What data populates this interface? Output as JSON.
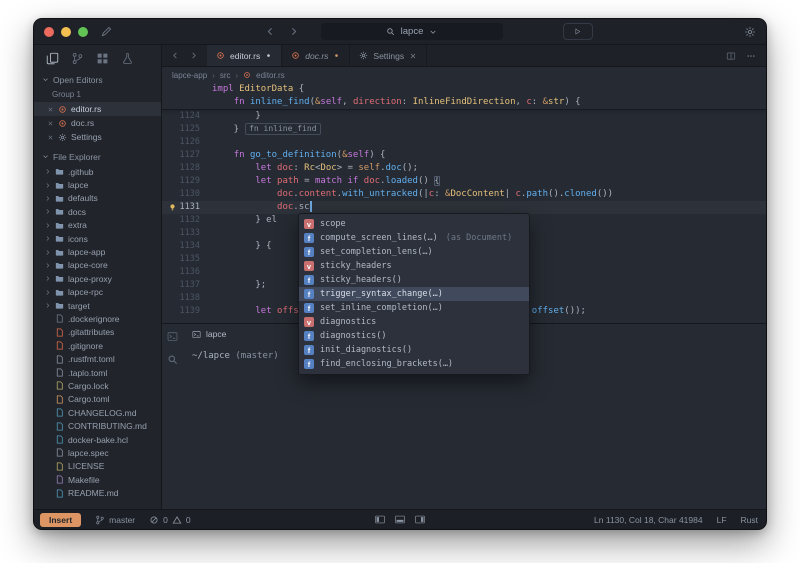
{
  "colors": {
    "accent_blue": "#61afef",
    "mode_insert": "#dd9563",
    "rust_orange": "#d87050",
    "folder": "#7f93ad",
    "traffic": [
      "#ec6a5e",
      "#f4bf50",
      "#61c454"
    ]
  },
  "titlebar": {
    "search_value": "lapce"
  },
  "activity": {
    "items": [
      {
        "name": "file-explorer",
        "icon": "files",
        "active": true
      },
      {
        "name": "source-control",
        "icon": "branch",
        "active": false
      },
      {
        "name": "extensions",
        "icon": "grid",
        "active": false
      },
      {
        "name": "debug",
        "icon": "flask",
        "active": false
      }
    ]
  },
  "sidebar": {
    "open_editors_label": "Open Editors",
    "group_label": "Group 1",
    "open_editors": [
      {
        "label": "editor.rs",
        "icon": "rust",
        "icon_color": "#d87050",
        "active": true
      },
      {
        "label": "doc.rs",
        "icon": "rust",
        "icon_color": "#d87050",
        "active": false
      },
      {
        "label": "Settings",
        "icon": "gear",
        "icon_color": "#8b93a2",
        "active": false
      }
    ],
    "file_explorer_label": "File Explorer",
    "tree": [
      {
        "label": ".github",
        "type": "folder"
      },
      {
        "label": "lapce",
        "type": "folder"
      },
      {
        "label": "defaults",
        "type": "folder"
      },
      {
        "label": "docs",
        "type": "folder"
      },
      {
        "label": "extra",
        "type": "folder"
      },
      {
        "label": "icons",
        "type": "folder"
      },
      {
        "label": "lapce-app",
        "type": "folder"
      },
      {
        "label": "lapce-core",
        "type": "folder"
      },
      {
        "label": "lapce-proxy",
        "type": "folder"
      },
      {
        "label": "lapce-rpc",
        "type": "folder"
      },
      {
        "label": "target",
        "type": "folder"
      },
      {
        "label": ".dockerignore",
        "type": "file",
        "color": "#6e7a8a"
      },
      {
        "label": ".gitattributes",
        "type": "file",
        "color": "#de6b48"
      },
      {
        "label": ".gitignore",
        "type": "file",
        "color": "#de6b48"
      },
      {
        "label": ".rustfmt.toml",
        "type": "file",
        "color": "#8b93a2"
      },
      {
        "label": ".taplo.toml",
        "type": "file",
        "color": "#8b93a2"
      },
      {
        "label": "Cargo.lock",
        "type": "file",
        "color": "#b8a965"
      },
      {
        "label": "Cargo.toml",
        "type": "file",
        "color": "#d19a66"
      },
      {
        "label": "CHANGELOG.md",
        "type": "file",
        "color": "#519aba"
      },
      {
        "label": "CONTRIBUTING.md",
        "type": "file",
        "color": "#519aba"
      },
      {
        "label": "docker-bake.hcl",
        "type": "file",
        "color": "#519aba"
      },
      {
        "label": "lapce.spec",
        "type": "file",
        "color": "#8b93a2"
      },
      {
        "label": "LICENSE",
        "type": "file",
        "color": "#b8a965"
      },
      {
        "label": "Makefile",
        "type": "file",
        "color": "#9a7fb8"
      },
      {
        "label": "README.md",
        "type": "file",
        "color": "#519aba"
      }
    ]
  },
  "tabs": {
    "items": [
      {
        "label": "editor.rs",
        "icon": "rust",
        "icon_color": "#d87050",
        "active": true,
        "modified": true,
        "dot_color": "#c6cdd9"
      },
      {
        "label": "doc.rs",
        "icon": "rust",
        "icon_color": "#d87050",
        "preview": true,
        "modified": true,
        "dot_color": "#d19a66"
      },
      {
        "label": "Settings",
        "icon": "gear",
        "icon_color": "#8b93a2",
        "closable": true
      }
    ]
  },
  "breadcrumb": {
    "items": [
      "lapce-app",
      "src",
      "editor.rs"
    ],
    "separator": "›"
  },
  "editor": {
    "sticky": [
      {
        "segs": [
          [
            "k",
            "impl "
          ],
          [
            "t",
            "EditorData"
          ],
          [
            "p",
            " {"
          ]
        ]
      },
      {
        "segs": [
          [
            "p",
            "    "
          ],
          [
            "k",
            "fn "
          ],
          [
            "f",
            "inline_find"
          ],
          [
            "p",
            "("
          ],
          [
            "o",
            "&"
          ],
          [
            "k",
            "self"
          ],
          [
            "p",
            ", "
          ],
          [
            "v",
            "direction"
          ],
          [
            "p",
            ": "
          ],
          [
            "t",
            "InlineFindDirection"
          ],
          [
            "p",
            ", "
          ],
          [
            "v",
            "c"
          ],
          [
            "p",
            ": "
          ],
          [
            "o",
            "&"
          ],
          [
            "t",
            "str"
          ],
          [
            "p",
            ") {"
          ]
        ]
      }
    ],
    "lines": [
      {
        "no": 1124,
        "segs": [
          [
            "p",
            "        }"
          ]
        ]
      },
      {
        "no": 1125,
        "segs": [
          [
            "p",
            "    }"
          ],
          [
            "ann",
            "fn inline_find"
          ]
        ]
      },
      {
        "no": 1126,
        "segs": []
      },
      {
        "no": 1127,
        "segs": [
          [
            "p",
            "    "
          ],
          [
            "k",
            "fn "
          ],
          [
            "f",
            "go_to_definition"
          ],
          [
            "p",
            "("
          ],
          [
            "o",
            "&"
          ],
          [
            "k",
            "self"
          ],
          [
            "p",
            ") {"
          ]
        ]
      },
      {
        "no": 1128,
        "segs": [
          [
            "p",
            "        "
          ],
          [
            "k",
            "let "
          ],
          [
            "v",
            "doc"
          ],
          [
            "p",
            ": "
          ],
          [
            "t",
            "Rc"
          ],
          [
            "p",
            "<"
          ],
          [
            "t",
            "Doc"
          ],
          [
            "p",
            "> = "
          ],
          [
            "o",
            "self"
          ],
          [
            "p",
            "."
          ],
          [
            "f",
            "doc"
          ],
          [
            "p",
            "();"
          ]
        ]
      },
      {
        "no": 1129,
        "segs": [
          [
            "p",
            "        "
          ],
          [
            "k",
            "let "
          ],
          [
            "v",
            "path"
          ],
          [
            "p",
            " = "
          ],
          [
            "k",
            "match "
          ],
          [
            "k",
            "if "
          ],
          [
            "v",
            "doc"
          ],
          [
            "p",
            "."
          ],
          [
            "f",
            "loaded"
          ],
          [
            "p",
            "() "
          ],
          [
            "box",
            "{"
          ]
        ]
      },
      {
        "no": 1130,
        "segs": [
          [
            "p",
            "            "
          ],
          [
            "v",
            "doc"
          ],
          [
            "p",
            "."
          ],
          [
            "v",
            "content"
          ],
          [
            "p",
            "."
          ],
          [
            "f",
            "with_untracked"
          ],
          [
            "p",
            "(|"
          ],
          [
            "v",
            "c"
          ],
          [
            "p",
            ": "
          ],
          [
            "o",
            "&"
          ],
          [
            "t",
            "DocContent"
          ],
          [
            "p",
            "| "
          ],
          [
            "v",
            "c"
          ],
          [
            "p",
            "."
          ],
          [
            "f",
            "path"
          ],
          [
            "p",
            "()."
          ],
          [
            "f",
            "cloned"
          ],
          [
            "p",
            "())"
          ]
        ]
      },
      {
        "no": 1131,
        "current": true,
        "bulb": true,
        "caret": true,
        "segs": [
          [
            "p",
            "            "
          ],
          [
            "v",
            "doc"
          ],
          [
            "p",
            "."
          ],
          [
            "p",
            "sc"
          ]
        ]
      },
      {
        "no": 1132,
        "segs": [
          [
            "p",
            "        } el"
          ]
        ]
      },
      {
        "no": 1133,
        "segs": []
      },
      {
        "no": 1134,
        "segs": [
          [
            "p",
            "        } {"
          ]
        ]
      },
      {
        "no": 1135,
        "segs": []
      },
      {
        "no": 1136,
        "segs": []
      },
      {
        "no": 1137,
        "segs": [
          [
            "p",
            "        };"
          ]
        ]
      },
      {
        "no": 1138,
        "segs": []
      },
      {
        "no": 1139,
        "segs": [
          [
            "p",
            "        "
          ],
          [
            "k",
            "let "
          ],
          [
            "v",
            "offset"
          ],
          [
            "p",
            " = "
          ],
          [
            "o",
            "self"
          ],
          [
            "p",
            "."
          ],
          [
            "v",
            "cursor"
          ],
          [
            "p",
            "."
          ],
          [
            "f",
            "with_untracked"
          ],
          [
            "p",
            "(|"
          ],
          [
            "v",
            "cursor"
          ],
          [
            "p",
            "| "
          ],
          [
            "v",
            "c"
          ],
          [
            "p",
            "."
          ],
          [
            "f",
            "offset"
          ],
          [
            "p",
            "());"
          ]
        ]
      }
    ]
  },
  "completion": {
    "selected_index": 5,
    "items": [
      {
        "kind": "v",
        "label": "scope"
      },
      {
        "kind": "f",
        "label": "compute_screen_lines(…)",
        "detail": "(as Document)"
      },
      {
        "kind": "f",
        "label": "set_completion_lens(…)"
      },
      {
        "kind": "v",
        "label": "sticky_headers"
      },
      {
        "kind": "f",
        "label": "sticky_headers()"
      },
      {
        "kind": "f",
        "label": "trigger_syntax_change(…)"
      },
      {
        "kind": "f",
        "label": "set_inline_completion(…)"
      },
      {
        "kind": "v",
        "label": "diagnostics"
      },
      {
        "kind": "f",
        "label": "diagnostics()"
      },
      {
        "kind": "f",
        "label": "init_diagnostics()"
      },
      {
        "kind": "f",
        "label": "find_enclosing_brackets(…)"
      }
    ]
  },
  "terminal": {
    "tab_label": "lapce",
    "prompt_path": "~/lapce",
    "prompt_branch": "(master)",
    "strip": [
      {
        "icon": "term",
        "name": "terminal-panel"
      },
      {
        "icon": "search",
        "name": "panel-search"
      }
    ]
  },
  "statusbar": {
    "mode": "Insert",
    "branch": "master",
    "errors": 0,
    "warnings": 0,
    "position": "Ln 1130, Col 18, Char 41984",
    "eol": "LF",
    "language": "Rust",
    "panels": [
      {
        "icon": "panelL",
        "name": "toggle-left-panel"
      },
      {
        "icon": "panelB",
        "name": "toggle-bottom-panel"
      },
      {
        "icon": "panelR",
        "name": "toggle-right-panel"
      }
    ]
  }
}
